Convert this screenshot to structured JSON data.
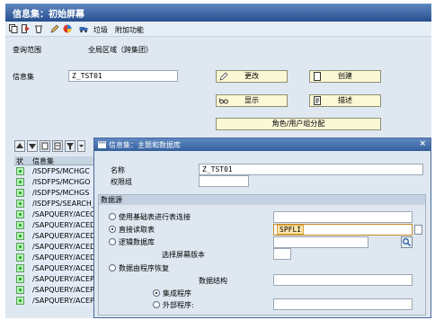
{
  "window": {
    "title": "信息集：初始屏幕"
  },
  "toolbar": {
    "trash_label": "垃圾",
    "addon_label": "附加功能"
  },
  "scope": {
    "label": "查询范围",
    "value": "全局区域（跨集团）"
  },
  "infoset": {
    "label": "信息集",
    "value": "Z_TST01"
  },
  "buttons": {
    "change": "更改",
    "create": "创建",
    "display": "显示",
    "describe": "描述",
    "role_user_group": "角色/用户组分配"
  },
  "list": {
    "header_status": "状",
    "header_name": "信息集",
    "rows": [
      "/ISDFPS/MCHGC",
      "/ISDFPS/MCHGO",
      "/ISDFPS/MCHGS",
      "/ISDFPS/SEARCH_19",
      "/SAPQUERY/ACECRM",
      "/SAPQUERY/ACEDSA",
      "/SAPQUERY/ACEDSF",
      "/SAPQUERY/ACEDSI",
      "/SAPQUERY/ACEDSI",
      "/SAPQUERY/ACEDSS",
      "/SAPQUERY/ACEPSF",
      "/SAPQUERY/ACEPSI",
      "/SAPQUERY/ACEPSI"
    ]
  },
  "dialog": {
    "title": "信息集：主题和数据库",
    "name_label": "名称",
    "name_value": "Z_TST01",
    "auth_group_label": "权限组",
    "auth_group_value": "",
    "datasource_label": "数据源",
    "opt_join": "使用基础表进行表连接",
    "opt_direct": "直接读取表",
    "direct_value": "SPFLI",
    "opt_logical_db": "逻辑数据库",
    "screen_version_label": "选择屏幕版本",
    "opt_program": "数据由程序恢复",
    "data_structure_label": "数据结构",
    "opt_integrated": "集成程序",
    "opt_external": "外部程序:"
  },
  "colors": {
    "title_bar": "#3a63a0",
    "button_bg": "#fbf8d6",
    "dialog_bg": "#dfe8f1"
  }
}
